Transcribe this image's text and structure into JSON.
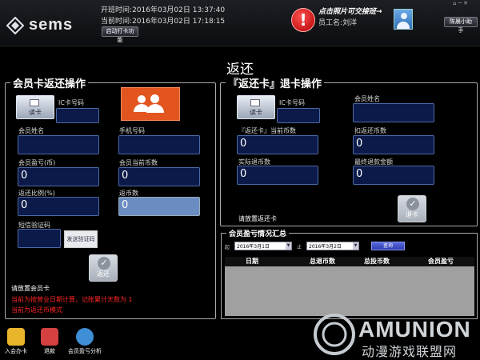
{
  "header": {
    "logo_text": "sems",
    "shift_start_label": "开班时间",
    "shift_start": "2016年03月02日 13:37:40",
    "current_time_label": "当前时间",
    "current_time": "2016年03月02日 17:18:15",
    "clock_in_button": "启动打卡功能",
    "alert_symbol": "!",
    "photo_tip": "点击照片可交接班→",
    "staff_label": "员工名",
    "staff_name": "刘洋",
    "assistant_button": "陈晨小助手",
    "window_controls": "⌂ ─ ✕"
  },
  "page": {
    "title": "返还"
  },
  "left_panel": {
    "title": "会员卡返还操作",
    "card_icon_caption": "读卡",
    "ic_card_label": "IC卡号码",
    "ic_card_value": "",
    "member_name_label": "会员姓名",
    "member_name_value": "",
    "phone_label": "手机号码",
    "phone_value": "",
    "profit_label": "会员盈亏(币)",
    "profit_value": "0",
    "current_coins_label": "会员当前币数",
    "current_coins_value": "0",
    "ratio_label": "返还比例(%)",
    "ratio_value": "0",
    "return_coins_label": "返币数",
    "return_coins_value": "0",
    "sms_label": "短信验证码",
    "sms_value": "",
    "sms_button": "发送验证码",
    "return_button": "返还",
    "place_card_hint": "请放置会员卡",
    "notice_1": "当前为按营业日期计算，记账累计天数为 1",
    "notice_2": "当前为返还币模式"
  },
  "right_panel": {
    "title": "『返还卡』退卡操作",
    "card_icon_caption": "读卡",
    "ic_card_label": "IC卡号码",
    "ic_card_value": "",
    "member_name_label": "会员姓名",
    "member_name_value": "",
    "current_coins_label": "『返还卡』当前币数",
    "current_coins_value": "0",
    "deduct_label": "扣返还币数",
    "deduct_value": "0",
    "actual_refund_label": "实际退币数",
    "actual_refund_value": "0",
    "final_refund_label": "最终退款金额",
    "final_refund_value": "0",
    "place_card_hint": "请放置返还卡",
    "refund_button": "退卡"
  },
  "summary": {
    "title": "会员盈亏情况汇总",
    "from_label": "起",
    "from_date": "2016年3月1日",
    "to_label": "止",
    "to_date": "2016年3月2日",
    "query_button": "查询",
    "columns": [
      "日期",
      "总退币数",
      "总投币数",
      "会员盈亏"
    ]
  },
  "dock": {
    "items": [
      {
        "label": "入会办卡",
        "color": "#e9b52a"
      },
      {
        "label": "退款",
        "color": "#d54040"
      },
      {
        "label": "会员盈亏分析",
        "color": "#3f8fd6"
      }
    ]
  },
  "watermark": {
    "text": "AMUNION",
    "sub": "动漫游戏联盟网"
  }
}
